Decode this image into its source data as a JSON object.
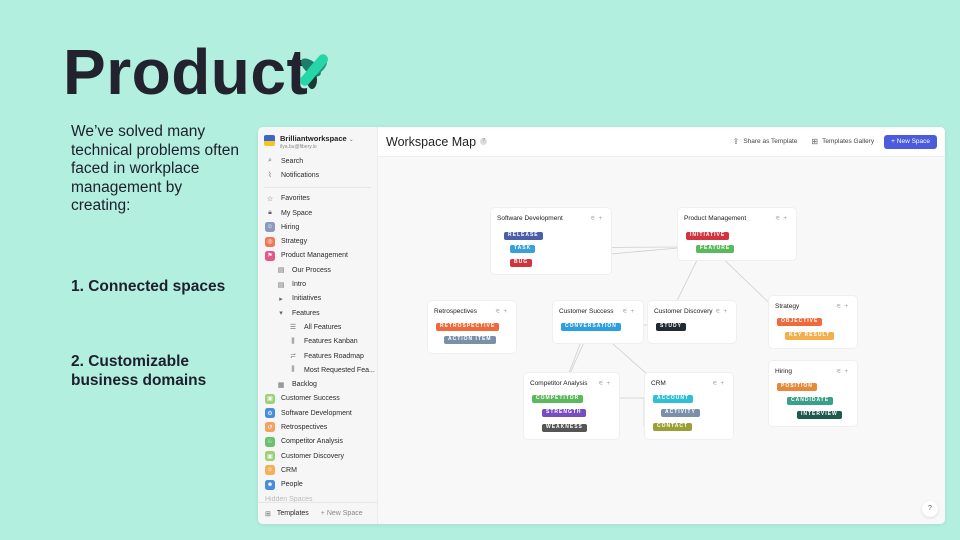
{
  "slide": {
    "title": "Product",
    "intro": "We’ve solved many technical problems often faced in workplace management by creating:",
    "points": [
      "1. Connected spaces",
      "2. Customizable business domains"
    ],
    "accent_color": "#b2efdf"
  },
  "app": {
    "workspace": {
      "name": "Brilliantworkspace",
      "email": "ilya.bu@fibery.io",
      "chevron": "⌄"
    },
    "sidebar": {
      "top_items": [
        {
          "label": "Search",
          "icon": "search-icon"
        },
        {
          "label": "Notifications",
          "icon": "notifications-icon"
        }
      ],
      "personal_items": [
        {
          "label": "Favorites",
          "icon": "star-icon"
        },
        {
          "label": "My Space",
          "icon": "lock-icon"
        }
      ],
      "spaces": [
        {
          "label": "Hiring",
          "icon": "hiring-icon",
          "color": "#8a9bbf"
        },
        {
          "label": "Strategy",
          "icon": "strategy-icon",
          "color": "#ef7a5a"
        },
        {
          "label": "Product Management",
          "icon": "product-icon",
          "color": "#e5578a"
        }
      ],
      "product_children": [
        {
          "label": "Our Process",
          "icon": "doc-icon",
          "level": 1
        },
        {
          "label": "Intro",
          "icon": "doc-icon",
          "level": 1
        },
        {
          "label": "Initiatives",
          "icon": "caret-right-icon",
          "level": 1
        },
        {
          "label": "Features",
          "icon": "caret-down-icon",
          "level": 1
        },
        {
          "label": "All Features",
          "icon": "list-view-icon",
          "level": 2
        },
        {
          "label": "Features Kanban",
          "icon": "board-view-icon",
          "level": 2
        },
        {
          "label": "Features Roadmap",
          "icon": "timeline-view-icon",
          "level": 2
        },
        {
          "label": "Most Requested Fea...",
          "icon": "board-view-icon",
          "level": 2
        },
        {
          "label": "Backlog",
          "icon": "table-view-icon",
          "level": 1
        }
      ],
      "more_spaces": [
        {
          "label": "Customer Success",
          "icon": "cs-icon",
          "color": "#9dd177"
        },
        {
          "label": "Software Development",
          "icon": "dev-icon",
          "color": "#4a8de0"
        },
        {
          "label": "Retrospectives",
          "icon": "retro-icon",
          "color": "#f4a261"
        },
        {
          "label": "Competitor Analysis",
          "icon": "competitor-icon",
          "color": "#6cc070"
        },
        {
          "label": "Customer Discovery",
          "icon": "discovery-icon",
          "color": "#9dd177"
        },
        {
          "label": "CRM",
          "icon": "crm-icon",
          "color": "#f4b058"
        },
        {
          "label": "People",
          "icon": "people-icon",
          "color": "#4a8de0"
        }
      ],
      "faded_item": "Hidden Spaces",
      "footer": {
        "templates": "Templates",
        "new_space": "+ New Space"
      }
    },
    "topbar": {
      "title": "Workspace Map",
      "info": "?",
      "share": "Share as Template",
      "gallery": "Templates Gallery",
      "new_space": "+ New Space"
    },
    "map": {
      "cards": [
        {
          "id": "softdev",
          "title": "Software Development",
          "tags": [
            {
              "label": "RELEASE",
              "color": "#4a5fa8"
            },
            {
              "label": "TASK",
              "color": "#3aa0d8"
            },
            {
              "label": "BUG",
              "color": "#d2343e"
            }
          ]
        },
        {
          "id": "pm",
          "title": "Product Management",
          "tags": [
            {
              "label": "INITIATIVE",
              "color": "#d2343e"
            },
            {
              "label": "FEATURE",
              "color": "#5cb85c"
            }
          ]
        },
        {
          "id": "retro",
          "title": "Retrospectives",
          "tags": [
            {
              "label": "RETROSPECTIVE",
              "color": "#ef6a3a"
            },
            {
              "label": "ACTION ITEM",
              "color": "#7b8fa8"
            }
          ]
        },
        {
          "id": "cs",
          "title": "Customer Success",
          "tags": [
            {
              "label": "CONVERSATION",
              "color": "#2d9fe0"
            }
          ]
        },
        {
          "id": "cd",
          "title": "Customer Discovery",
          "tags": [
            {
              "label": "STUDY",
              "color": "#1f2a33"
            }
          ]
        },
        {
          "id": "strategy",
          "title": "Strategy",
          "tags": [
            {
              "label": "OBJECTIVE",
              "color": "#ef6a3a"
            },
            {
              "label": "KEY RESULT",
              "color": "#f2b04a"
            }
          ]
        },
        {
          "id": "hiring",
          "title": "Hiring",
          "tags": [
            {
              "label": "POSITION",
              "color": "#e58a3a"
            },
            {
              "label": "CANDIDATE",
              "color": "#3aa08a"
            },
            {
              "label": "INTERVIEW",
              "color": "#1f5a4e"
            }
          ]
        },
        {
          "id": "comp",
          "title": "Competitor Analysis",
          "tags": [
            {
              "label": "COMPETITOR",
              "color": "#5cb85c"
            },
            {
              "label": "STRENGTH",
              "color": "#7a4cc2"
            },
            {
              "label": "WEAKNESS",
              "color": "#555555"
            }
          ]
        },
        {
          "id": "crm",
          "title": "CRM",
          "tags": [
            {
              "label": "ACCOUNT",
              "color": "#2fc0d8"
            },
            {
              "label": "ACTIVITY",
              "color": "#7b8fa8"
            },
            {
              "label": "CONTACT",
              "color": "#9aa036"
            }
          ]
        }
      ],
      "help": "?"
    }
  }
}
